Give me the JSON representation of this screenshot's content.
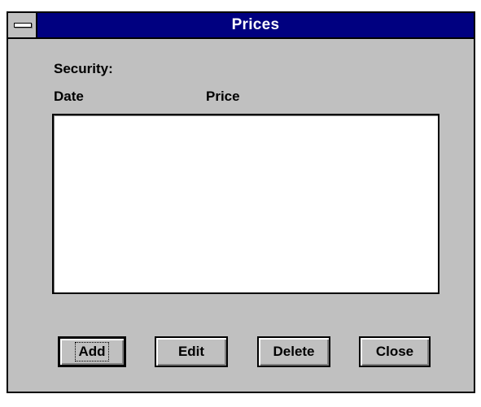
{
  "window": {
    "title": "Prices"
  },
  "labels": {
    "security": "Security:",
    "date": "Date",
    "price": "Price"
  },
  "buttons": {
    "add": "Add",
    "edit": "Edit",
    "delete": "Delete",
    "close": "Close"
  },
  "icons": {
    "system_menu": "system-menu-icon"
  },
  "colors": {
    "titlebar": "#000080",
    "window_background": "#c0c0c0",
    "listbox_background": "#ffffff"
  }
}
